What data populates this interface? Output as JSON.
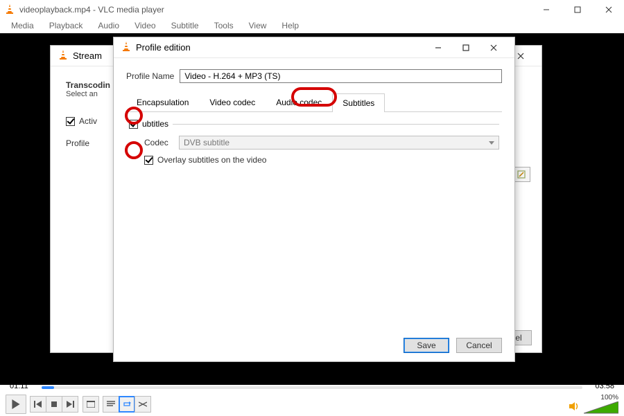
{
  "main": {
    "title": "videoplayback.mp4 - VLC media player",
    "menu": [
      "Media",
      "Playback",
      "Audio",
      "Video",
      "Subtitle",
      "Tools",
      "View",
      "Help"
    ],
    "time_left": "01:11",
    "time_right": "03:58",
    "volume_label": "100%"
  },
  "stream": {
    "title": "Stream",
    "heading": "Transcodin",
    "subhead": "Select an",
    "activate_label": "Activ",
    "profile_label": "Profile",
    "question": "?",
    "cancel": "Cancel"
  },
  "profile": {
    "title": "Profile edition",
    "name_label": "Profile Name",
    "name_value": "Video - H.264 + MP3 (TS)",
    "tabs": [
      "Encapsulation",
      "Video codec",
      "Audio codec",
      "Subtitles"
    ],
    "active_tab": "Subtitles",
    "group_label": "ubtitles",
    "codec_label": "Codec",
    "codec_value": "DVB subtitle",
    "overlay_label": "Overlay subtitles on the video",
    "save": "Save",
    "cancel": "Cancel"
  }
}
